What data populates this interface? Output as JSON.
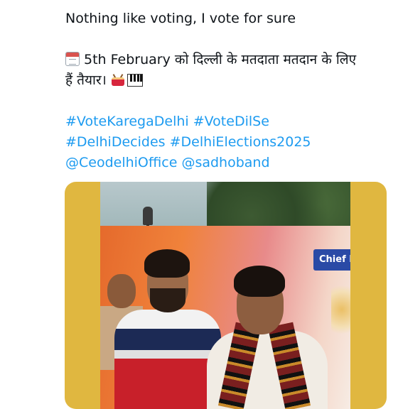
{
  "tweet": {
    "line1": "Nothing like voting, I vote for sure",
    "line2_text": "5th February को दिल्ली के मतदाता मतदान के लिए",
    "line3_text": "हैं तैयार।",
    "hashtags": [
      "#VoteKaregaDelhi",
      "#VoteDilSe",
      "#DelhiDecides",
      "#DelhiElections2025"
    ],
    "mentions": [
      "@CeodelhiOffice",
      "@sadhoband"
    ],
    "icons": [
      "calendar-icon",
      "drum-icon",
      "piano-icon"
    ]
  },
  "media": {
    "banner_text": "Chief E",
    "background_color": "#e0b740"
  },
  "colors": {
    "link": "#1d9bf0",
    "text": "#0f1419"
  }
}
